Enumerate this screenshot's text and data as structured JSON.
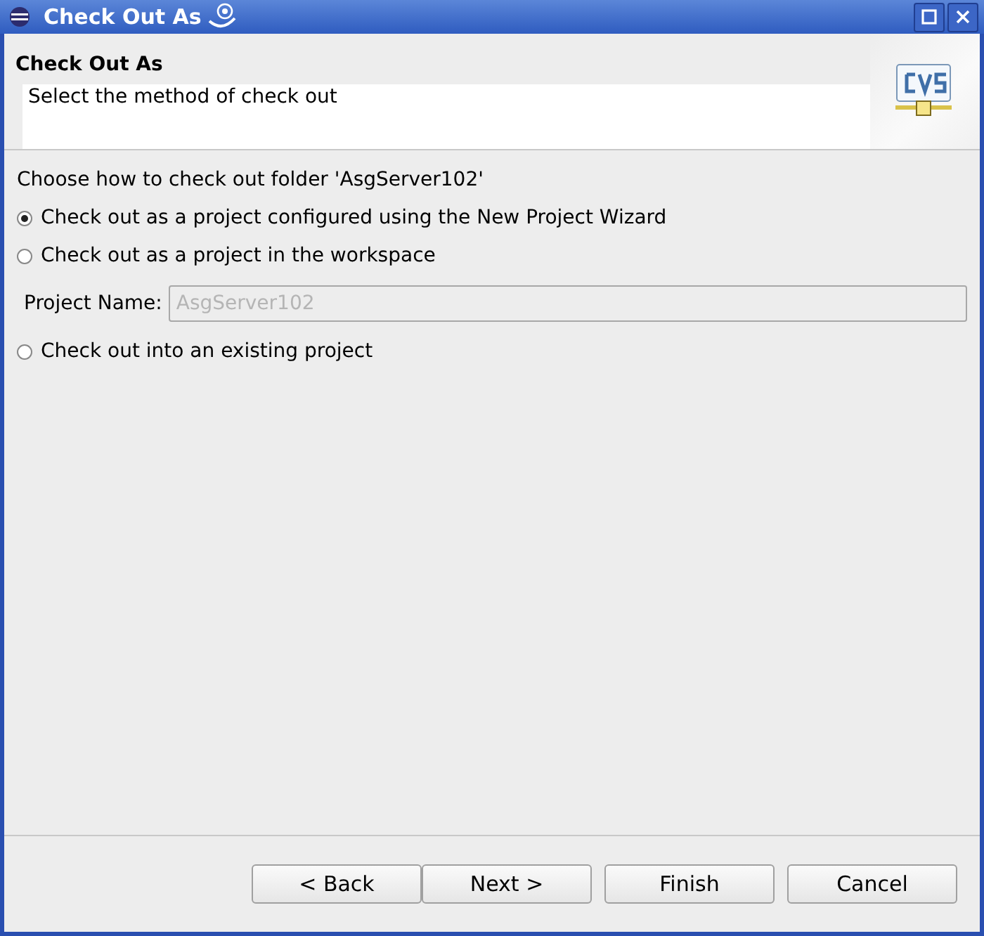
{
  "window": {
    "title": "Check Out As"
  },
  "header": {
    "title": "Check Out As",
    "description": "Select the method of check out"
  },
  "prompt": "Choose how to check out folder 'AsgServer102'",
  "options": [
    {
      "label": "Check out as a project configured using the New Project Wizard",
      "selected": true,
      "kind": "radio"
    },
    {
      "label": "Check out as a project in the workspace",
      "selected": false,
      "kind": "radio"
    },
    {
      "kind": "field",
      "label": "Project Name:",
      "value": "AsgServer102",
      "disabled": true
    },
    {
      "label": "Check out into an existing project",
      "selected": false,
      "kind": "radio"
    }
  ],
  "buttons": [
    {
      "label": "< Back",
      "disabled": false
    },
    {
      "label": "Next >",
      "disabled": false
    },
    {
      "label": "Finish",
      "disabled": false
    },
    {
      "label": "Cancel",
      "disabled": false
    }
  ]
}
